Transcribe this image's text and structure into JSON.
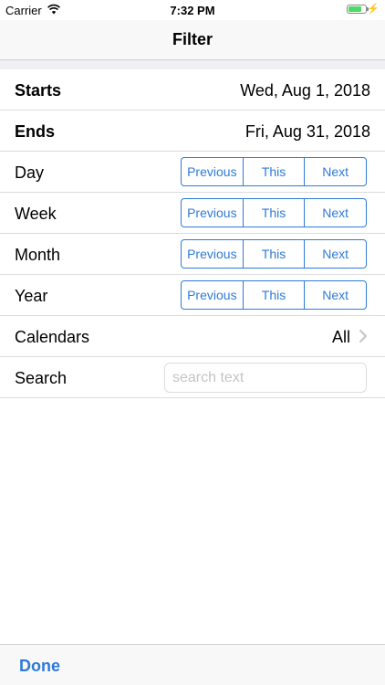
{
  "status": {
    "carrier": "Carrier",
    "time": "7:32 PM",
    "battery_level": 0.7
  },
  "nav": {
    "title": "Filter"
  },
  "rows": {
    "starts": {
      "label": "Starts",
      "value": "Wed, Aug 1, 2018"
    },
    "ends": {
      "label": "Ends",
      "value": "Fri, Aug 31, 2018"
    },
    "day": {
      "label": "Day"
    },
    "week": {
      "label": "Week"
    },
    "month": {
      "label": "Month"
    },
    "year": {
      "label": "Year"
    },
    "calendars": {
      "label": "Calendars",
      "value": "All"
    },
    "search": {
      "label": "Search",
      "placeholder": "search text"
    }
  },
  "segment": {
    "previous": "Previous",
    "this": "This",
    "next": "Next"
  },
  "toolbar": {
    "done": "Done"
  },
  "colors": {
    "accent": "#2f7ad8",
    "battery": "#4cd964"
  }
}
